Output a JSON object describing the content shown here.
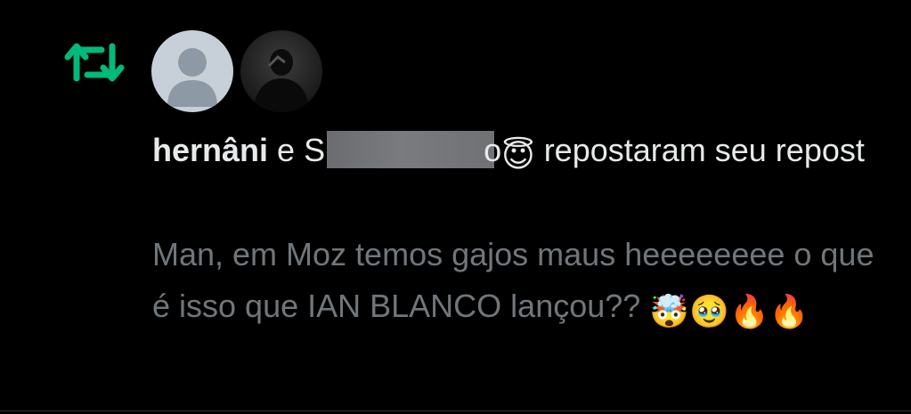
{
  "notification": {
    "type_icon": "repost-icon",
    "accent_color": "#00ba7c",
    "avatars": [
      {
        "name": "avatar-default-profile",
        "style": "default-silhouette"
      },
      {
        "name": "avatar-photo",
        "style": "dark-photo"
      }
    ],
    "header": {
      "user1": "hernâni",
      "conjunction": "e",
      "user2_redacted": "S",
      "user2_tail": "o",
      "user2_emoji": "😇",
      "action": "repostaram seu repost"
    },
    "tweet_text": "Man, em Moz temos gajos maus heeeeeeee o que é isso que IAN BLANCO lançou??",
    "tweet_emojis": [
      "🤯",
      "🥹",
      "🔥",
      "🔥"
    ]
  },
  "colors": {
    "background": "#000000",
    "primary_text": "#e7e9ea",
    "secondary_text": "#71767b",
    "repost_green": "#00ba7c",
    "divider": "#2f3336"
  }
}
